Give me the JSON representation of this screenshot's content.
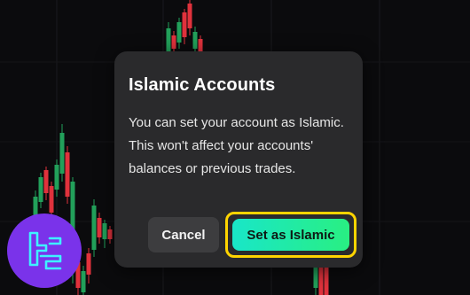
{
  "dialog": {
    "title": "Islamic Accounts",
    "message": "You can set your account as Islamic. This won't affect your accounts' balances or previous trades.",
    "cancel_label": "Cancel",
    "confirm_label": "Set as Islamic"
  },
  "colors": {
    "dialog_background": "#2a2a2c",
    "confirm_gradient_start": "#19e6c8",
    "confirm_gradient_end": "#29ef82",
    "highlight_border": "#ffd400",
    "candle_up": "#22a05a",
    "candle_down": "#e0323c",
    "logo_background": "#7a33ea",
    "logo_stroke": "#3ef2ff"
  },
  "icons": {
    "brand_logo": "tradingfinder-logo"
  }
}
